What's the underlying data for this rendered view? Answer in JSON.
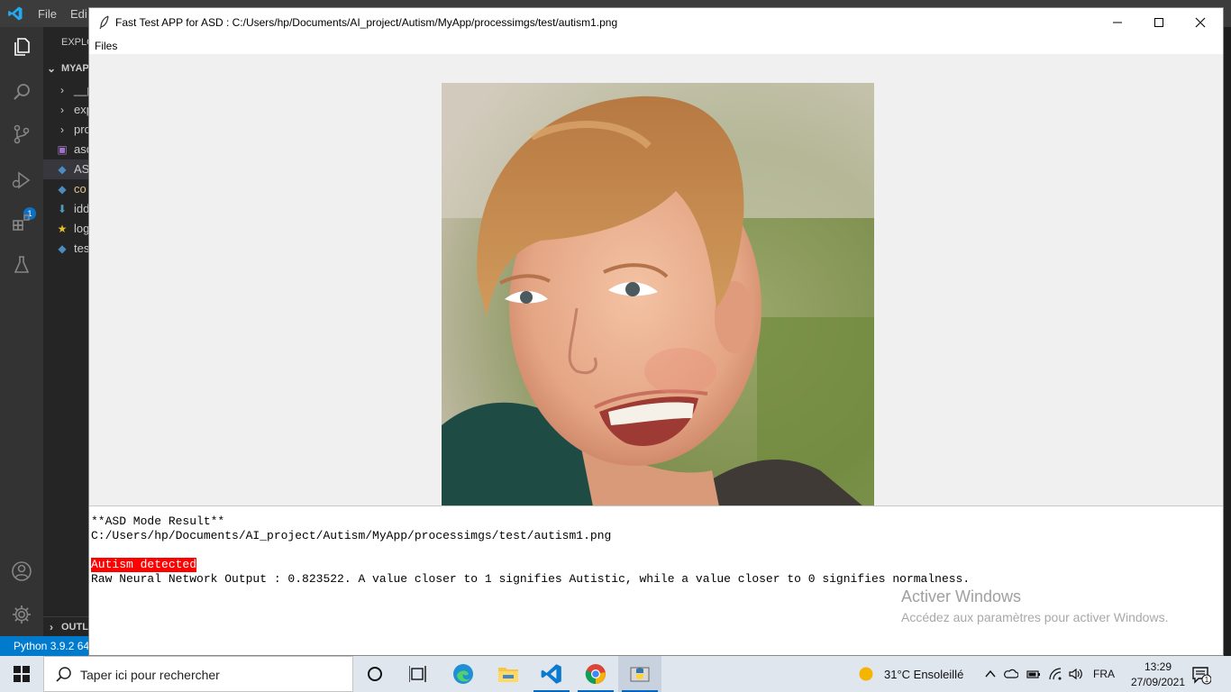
{
  "vscode": {
    "menu": [
      "File",
      "Edi"
    ],
    "sidebar_header": "EXPLO",
    "project": "MYAP",
    "items": [
      {
        "label": "__p",
        "kind": "folder"
      },
      {
        "label": "exp",
        "kind": "folder"
      },
      {
        "label": "pro",
        "kind": "folder"
      },
      {
        "label": "asd",
        "kind": "image"
      },
      {
        "label": "AS",
        "kind": "python"
      },
      {
        "label": "co",
        "kind": "python"
      },
      {
        "label": "idd",
        "kind": "download"
      },
      {
        "label": "log",
        "kind": "star"
      },
      {
        "label": "tes",
        "kind": "python"
      }
    ],
    "outline_label": "OUTLI",
    "debug_badge": "1",
    "status_python": "Python 3.9.2 64"
  },
  "app": {
    "title": "Fast Test APP for ASD : C:/Users/hp/Documents/AI_project/Autism/MyApp/processimgs/test/autism1.png",
    "menu_files": "Files",
    "result_header": "**ASD Mode Result**",
    "result_path": "C:/Users/hp/Documents/AI_project/Autism/MyApp/processimgs/test/autism1.png",
    "result_label": "Autism detected",
    "result_detail": "Raw Neural Network Output : 0.823522. A value closer to 1 signifies Autistic, while a value closer to 0 signifies normalness.",
    "raw_output": 0.823522,
    "label_color": "#ff0000"
  },
  "watermark": {
    "title": "Activer Windows",
    "subtitle": "Accédez aux paramètres pour activer Windows."
  },
  "taskbar": {
    "search_placeholder": "Taper ici pour rechercher",
    "weather": "31°C  Ensoleillé",
    "language": "FRA",
    "time": "13:29",
    "date": "27/09/2021",
    "notification_count": "1",
    "apps": [
      "cortana-icon",
      "task-view-icon",
      "edge-icon",
      "file-explorer-icon",
      "vscode-icon",
      "chrome-icon",
      "python-app-icon"
    ]
  }
}
